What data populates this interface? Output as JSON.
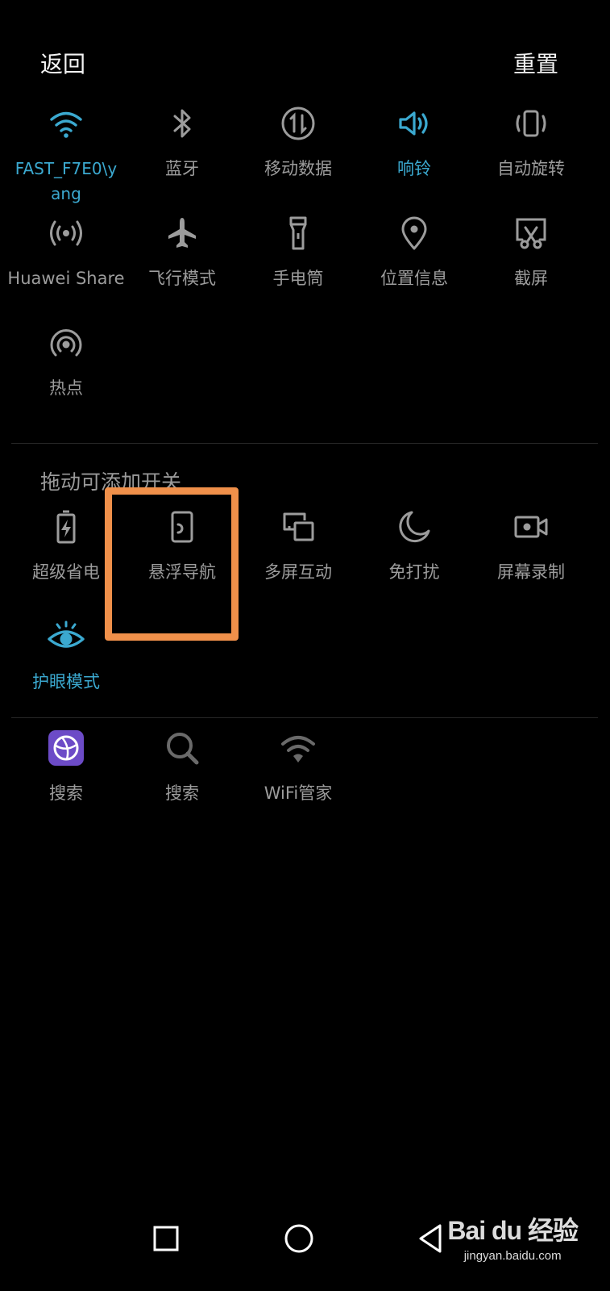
{
  "header": {
    "back_label": "返回",
    "reset_label": "重置"
  },
  "active_tiles": [
    {
      "label": "FAST_F7E0\\yang",
      "icon": "wifi-icon",
      "on": true
    },
    {
      "label": "蓝牙",
      "icon": "bluetooth-icon",
      "on": false
    },
    {
      "label": "移动数据",
      "icon": "mobile-data-icon",
      "on": false
    },
    {
      "label": "响铃",
      "icon": "ringer-icon",
      "on": true
    },
    {
      "label": "自动旋转",
      "icon": "auto-rotate-icon",
      "on": false
    },
    {
      "label": "Huawei Share",
      "icon": "huawei-share-icon",
      "on": false
    },
    {
      "label": "飞行模式",
      "icon": "airplane-icon",
      "on": false
    },
    {
      "label": "手电筒",
      "icon": "flashlight-icon",
      "on": false
    },
    {
      "label": "位置信息",
      "icon": "location-icon",
      "on": false
    },
    {
      "label": "截屏",
      "icon": "screenshot-icon",
      "on": false
    },
    {
      "label": "热点",
      "icon": "hotspot-icon",
      "on": false
    }
  ],
  "add_section": {
    "title": "拖动可添加开关",
    "tiles": [
      {
        "label": "超级省电",
        "icon": "battery-saver-icon",
        "on": false
      },
      {
        "label": "悬浮导航",
        "icon": "floating-nav-icon",
        "on": false
      },
      {
        "label": "多屏互动",
        "icon": "multi-screen-icon",
        "on": false
      },
      {
        "label": "免打扰",
        "icon": "moon-icon",
        "on": false
      },
      {
        "label": "屏幕录制",
        "icon": "screen-record-icon",
        "on": false
      },
      {
        "label": "护眼模式",
        "icon": "eye-icon",
        "on": true
      }
    ]
  },
  "third_party": [
    {
      "label": "搜索",
      "icon": "browser-search-icon"
    },
    {
      "label": "搜索",
      "icon": "search-icon"
    },
    {
      "label": "WiFi管家",
      "icon": "wifi-manager-icon"
    }
  ],
  "navbar": {
    "icons": [
      "recent-apps-icon",
      "home-icon",
      "back-icon"
    ]
  },
  "watermark": {
    "logo": "Bai du 经验",
    "url": "jingyan.baidu.com"
  },
  "colors": {
    "accent": "#3ba9d0",
    "highlight": "#f0904a",
    "inactive": "#9c9c9c",
    "background": "#000000"
  }
}
